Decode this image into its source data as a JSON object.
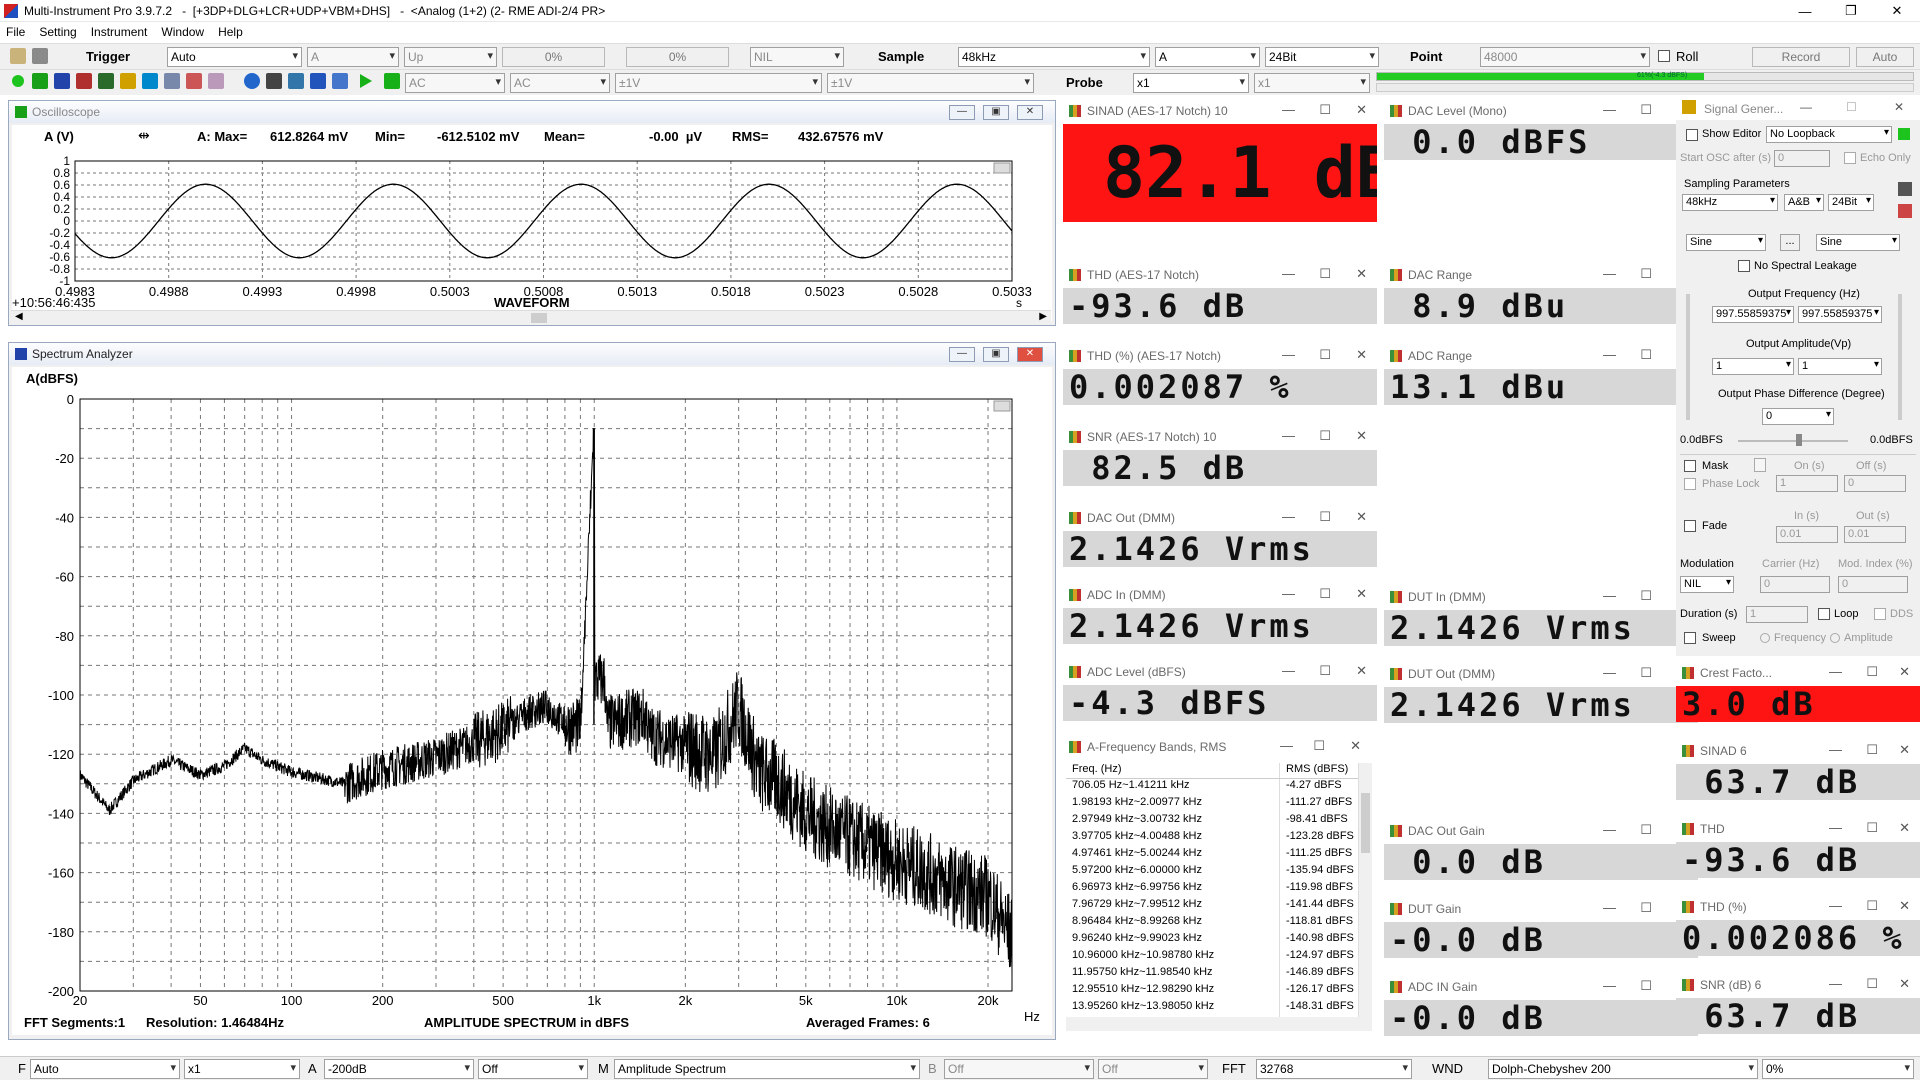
{
  "app": {
    "title": "Multi-Instrument Pro 3.9.7.2   -  [+3DP+DLG+LCR+UDP+VBM+DHS]   -  <Analog (1+2) (2- RME ADI-2/4 PR>"
  },
  "menu": [
    "File",
    "Setting",
    "Instrument",
    "Window",
    "Help"
  ],
  "toolbar1": {
    "trigger_label": "Trigger",
    "trigger_mode": "Auto",
    "trigger_channel": "A",
    "trigger_edge": "Up",
    "trigger_level": "0%",
    "trigger_delay": "0%",
    "trigger_nil": "NIL",
    "sample_label": "Sample",
    "sample_rate": "48kHz",
    "sample_channel": "A",
    "bit_depth": "24Bit",
    "point_label": "Point",
    "point_value": "48000",
    "roll_label": "Roll",
    "record_label": "Record",
    "auto_label": "Auto"
  },
  "toolbar2": {
    "coupling_a": "AC",
    "coupling_b": "AC",
    "range_a": "±1V",
    "range_b": "±1V",
    "probe_label": "Probe",
    "probe_a": "x1",
    "probe_b": "x1",
    "level_meter": "61%(-4.3 dBFS)",
    "level_fraction": 0.61
  },
  "oscilloscope": {
    "title": "Oscilloscope",
    "channel_label": "A (V)",
    "stats_label": "A: Max=",
    "max": "612.8264 mV",
    "min_label": "Min=",
    "min": "-612.5102 mV",
    "mean_label": "Mean=",
    "mean": "-0.00  µV",
    "rms_label": "RMS=",
    "rms": "432.67576 mV",
    "y_ticks": [
      "1",
      "0.8",
      "0.6",
      "0.4",
      "0.2",
      "0",
      "-0.2",
      "-0.4",
      "-0.6",
      "-0.8",
      "-1"
    ],
    "x_ticks": [
      "0.4983",
      "0.4988",
      "0.4993",
      "0.4998",
      "0.5003",
      "0.5008",
      "0.5013",
      "0.5018",
      "0.5023",
      "0.5028",
      "0.5033"
    ],
    "x_unit": "s",
    "timestamp": "+10:56:46:435",
    "caption": "WAVEFORM"
  },
  "chart_data": [
    {
      "type": "line",
      "xlim": [
        0.4983,
        0.5033
      ],
      "ylim": [
        -1,
        1
      ],
      "series": [
        {
          "frequency_hz": 997.56,
          "amplitude": 0.6128,
          "start_phase_deg": 200
        }
      ]
    },
    {
      "type": "line",
      "x_scale": "log",
      "xlim": [
        20,
        24000
      ],
      "ylim": [
        -200,
        0
      ],
      "series": [
        {
          "x": [
            20,
            25,
            30,
            40,
            50,
            60,
            70,
            80,
            100,
            150,
            200,
            300,
            400,
            500,
            600,
            700,
            800,
            900,
            997.56,
            1100,
            1300,
            1500,
            1995,
            2500,
            2993,
            3500,
            4000,
            5000,
            6000,
            8000,
            10000,
            12000,
            15000,
            20000,
            24000
          ],
          "y": [
            -127,
            -139,
            -129,
            -122,
            -127,
            -124,
            -118,
            -122,
            -126,
            -130,
            -125,
            -121,
            -116,
            -112,
            -106,
            -104,
            -110,
            -111,
            -10,
            -110,
            -108,
            -107,
            -111,
            -115,
            -98,
            -120,
            -123,
            -134,
            -139,
            -145,
            -150,
            -153,
            -158,
            -162,
            -176
          ]
        }
      ]
    }
  ],
  "spectrum": {
    "title": "Spectrum Analyzer",
    "y_label": "A(dBFS)",
    "y_ticks": [
      "0",
      "-20",
      "-40",
      "-60",
      "-80",
      "-100",
      "-120",
      "-140",
      "-160",
      "-180",
      "-200"
    ],
    "x_ticks": [
      "20",
      "50",
      "100",
      "200",
      "500",
      "1k",
      "2k",
      "5k",
      "10k",
      "20k"
    ],
    "x_unit": "Hz",
    "fft_segments": "FFT Segments:1",
    "resolution": "Resolution: 1.46484Hz",
    "caption": "AMPLITUDE SPECTRUM in dBFS",
    "averaged": "Averaged Frames: 6"
  },
  "meters_col1": [
    {
      "title": "SINAD (AES-17 Notch)  10",
      "value": "82.1 dB",
      "red": true
    },
    {
      "title": "THD (AES-17 Notch)",
      "value": "-93.6 dB"
    },
    {
      "title": "THD (%) (AES-17 Notch)",
      "value": "0.002087 %"
    },
    {
      "title": "SNR (AES-17 Notch)  10",
      "value": " 82.5 dB"
    },
    {
      "title": "DAC Out (DMM)",
      "value": "2.1426 Vrms"
    },
    {
      "title": "ADC In (DMM)",
      "value": "2.1426 Vrms"
    },
    {
      "title": "ADC Level (dBFS)",
      "value": "-4.3 dBFS"
    }
  ],
  "meters_col2": [
    {
      "title": "DAC Level (Mono)",
      "value": " 0.0 dBFS"
    },
    {
      "title": "DAC Range",
      "value": " 8.9 dBu"
    },
    {
      "title": "ADC Range",
      "value": "13.1 dBu"
    },
    {
      "title": "DUT In (DMM)",
      "value": "2.1426 Vrms"
    },
    {
      "title": "DUT Out (DMM)",
      "value": "2.1426 Vrms"
    },
    {
      "title": "DAC Out Gain",
      "value": " 0.0 dB"
    },
    {
      "title": "DUT Gain",
      "value": "-0.0 dB"
    },
    {
      "title": "ADC IN Gain",
      "value": "-0.0 dB"
    }
  ],
  "meters_col3": [
    {
      "title": "Crest Facto...",
      "value": "3.0 dB",
      "red": true
    },
    {
      "title": "SINAD  6",
      "value": " 63.7 dB"
    },
    {
      "title": "THD",
      "value": "-93.6 dB"
    },
    {
      "title": "THD (%)",
      "value": "0.002086 %"
    },
    {
      "title": "SNR (dB)  6",
      "value": " 63.7 dB"
    }
  ],
  "freq_bands": {
    "title": "A-Frequency Bands, RMS",
    "headers": [
      "Freq. (Hz)",
      "RMS (dBFS)"
    ],
    "rows": [
      [
        "706.05 Hz~1.41211 kHz",
        "-4.27 dBFS"
      ],
      [
        "1.98193 kHz~2.00977 kHz",
        "-111.27 dBFS"
      ],
      [
        "2.97949 kHz~3.00732 kHz",
        "-98.41 dBFS"
      ],
      [
        "3.97705 kHz~4.00488 kHz",
        "-123.28 dBFS"
      ],
      [
        "4.97461 kHz~5.00244 kHz",
        "-111.25 dBFS"
      ],
      [
        "5.97200 kHz~6.00000 kHz",
        "-135.94 dBFS"
      ],
      [
        "6.96973 kHz~6.99756 kHz",
        "-119.98 dBFS"
      ],
      [
        "7.96729 kHz~7.99512 kHz",
        "-141.44 dBFS"
      ],
      [
        "8.96484 kHz~8.99268 kHz",
        "-118.81 dBFS"
      ],
      [
        "9.96240 kHz~9.99023 kHz",
        "-140.98 dBFS"
      ],
      [
        "10.96000 kHz~10.98780 kHz",
        "-124.97 dBFS"
      ],
      [
        "11.95750 kHz~11.98540 kHz",
        "-146.89 dBFS"
      ],
      [
        "12.95510 kHz~12.98290 kHz",
        "-126.17 dBFS"
      ],
      [
        "13.95260 kHz~13.98050 kHz",
        "-148.31 dBFS"
      ]
    ]
  },
  "siggen": {
    "title": "Signal Gener...",
    "show_editor": "Show Editor",
    "loopback": "No Loopback",
    "start_osc": "Start OSC after (s)",
    "start_osc_val": "0",
    "echo_only": "Echo Only",
    "sampling_params": "Sampling Parameters",
    "rate": "48kHz",
    "channels": "A&B",
    "bits": "24Bit",
    "wave_a": "Sine",
    "wave_b": "Sine",
    "wave_btn": "...",
    "no_leakage": "No Spectral Leakage",
    "freq_label": "Output Frequency (Hz)",
    "freq_a": "997.55859375",
    "freq_b": "997.55859375",
    "amp_label": "Output Amplitude(Vp)",
    "amp_a": "1",
    "amp_b": "1",
    "phase_label": "Output Phase Difference (Degree)",
    "phase": "0",
    "lvl_left": "0.0dBFS",
    "lvl_right": "0.0dBFS",
    "mask": "Mask",
    "on_s": "On (s)",
    "off_s": "Off (s)",
    "phase_lock": "Phase Lock",
    "pl_on": "1",
    "pl_off": "0",
    "fade": "Fade",
    "in_s": "In (s)",
    "out_s": "Out (s)",
    "fade_in": "0.01",
    "fade_out": "0.01",
    "modulation": "Modulation",
    "carrier": "Carrier (Hz)",
    "mod_index": "Mod. Index (%)",
    "mod_type": "NIL",
    "carrier_val": "0",
    "mod_val": "0",
    "duration": "Duration (s)",
    "duration_val": "1",
    "loop": "Loop",
    "dds": "DDS",
    "sweep": "Sweep",
    "frequency": "Frequency",
    "amplitude": "Amplitude"
  },
  "statusbar": {
    "f_label": "F",
    "f_mode": "Auto",
    "f_scale": "x1",
    "a_label": "A",
    "a_min": "-200dB",
    "a_off": "Off",
    "m_label": "M",
    "m_mode": "Amplitude Spectrum",
    "b_label": "B",
    "b_off": "Off",
    "b_off2": "Off",
    "fft_label": "FFT",
    "fft_size": "32768",
    "wnd_label": "WND",
    "window": "Dolph-Chebyshev 200",
    "pct": "0%"
  },
  "colors": {
    "alarm_red": "#ff1414",
    "meter_bg": "#d7d7d7",
    "level_green": "#22cc22"
  }
}
